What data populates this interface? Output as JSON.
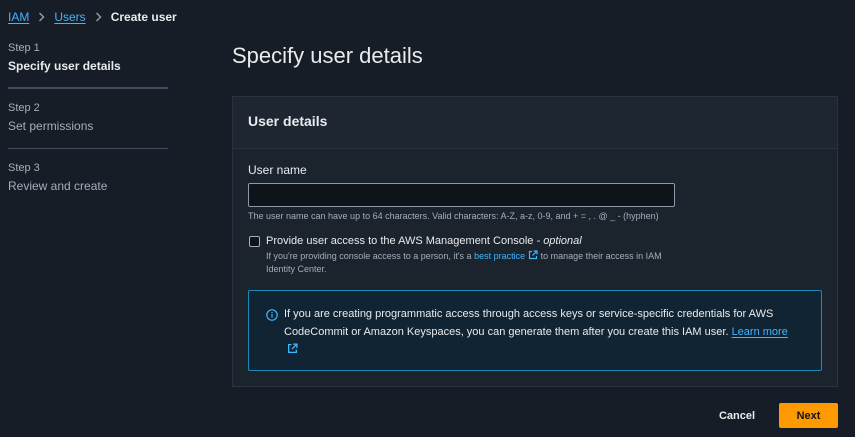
{
  "breadcrumb": {
    "items": [
      {
        "label": "IAM"
      },
      {
        "label": "Users"
      },
      {
        "label": "Create user"
      }
    ]
  },
  "steps": [
    {
      "number": "Step 1",
      "title": "Specify user details",
      "active": true
    },
    {
      "number": "Step 2",
      "title": "Set permissions",
      "active": false
    },
    {
      "number": "Step 3",
      "title": "Review and create",
      "active": false
    }
  ],
  "main": {
    "title": "Specify user details",
    "container": {
      "header": "User details",
      "username": {
        "label": "User name",
        "value": "",
        "hint": "The user name can have up to 64 characters. Valid characters: A-Z, a-z, 0-9, and + = , . @ _ - (hyphen)"
      },
      "console_access": {
        "checked": false,
        "label": "Provide user access to the AWS Management Console",
        "label_suffix": "- optional",
        "desc_before": "If you're providing console access to a person, it's a",
        "desc_link": "best practice",
        "desc_after": "to manage their access in IAM Identity Center."
      },
      "alert": {
        "icon": "info-circle-icon",
        "text": "If you are creating programmatic access through access keys or service-specific credentials for AWS CodeCommit or Amazon Keyspaces, you can generate them after you create this IAM user.",
        "link": "Learn more"
      }
    }
  },
  "footer": {
    "cancel_label": "Cancel",
    "next_label": "Next"
  },
  "colors": {
    "link": "#42b4ff",
    "primary_button": "#ff9900",
    "alert_border": "#1a8ab8"
  }
}
